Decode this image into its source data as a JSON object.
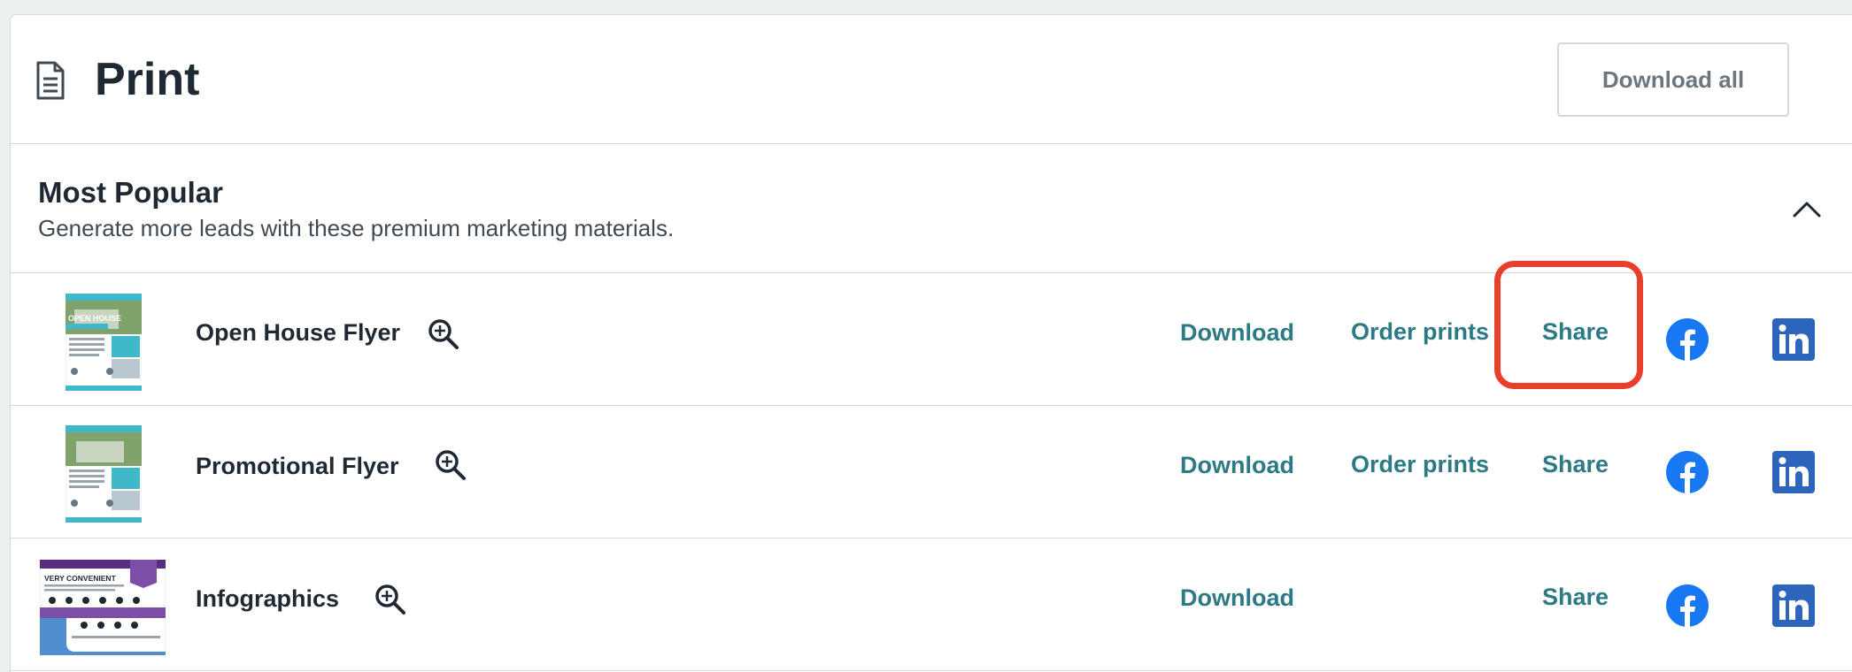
{
  "header": {
    "title": "Print",
    "download_all_label": "Download all",
    "icon": "document-icon"
  },
  "section": {
    "title": "Most Popular",
    "subtitle": "Generate more leads with these premium marketing materials.",
    "collapse_icon": "chevron-up-icon"
  },
  "items": [
    {
      "name": "Open House Flyer",
      "download": "Download",
      "order_prints": "Order prints",
      "share": "Share"
    },
    {
      "name": "Promotional Flyer",
      "download": "Download",
      "order_prints": "Order prints",
      "share": "Share"
    },
    {
      "name": "Infographics",
      "download": "Download",
      "share": "Share"
    }
  ],
  "thumbs": {
    "flyer_banner": "OPEN HOUSE",
    "infographic_heading": "VERY CONVENIENT"
  },
  "colors": {
    "action_teal": "#2b7a84",
    "highlight_red": "#e8402c",
    "facebook_blue": "#1877f2",
    "linkedin_blue": "#2d64bc"
  }
}
